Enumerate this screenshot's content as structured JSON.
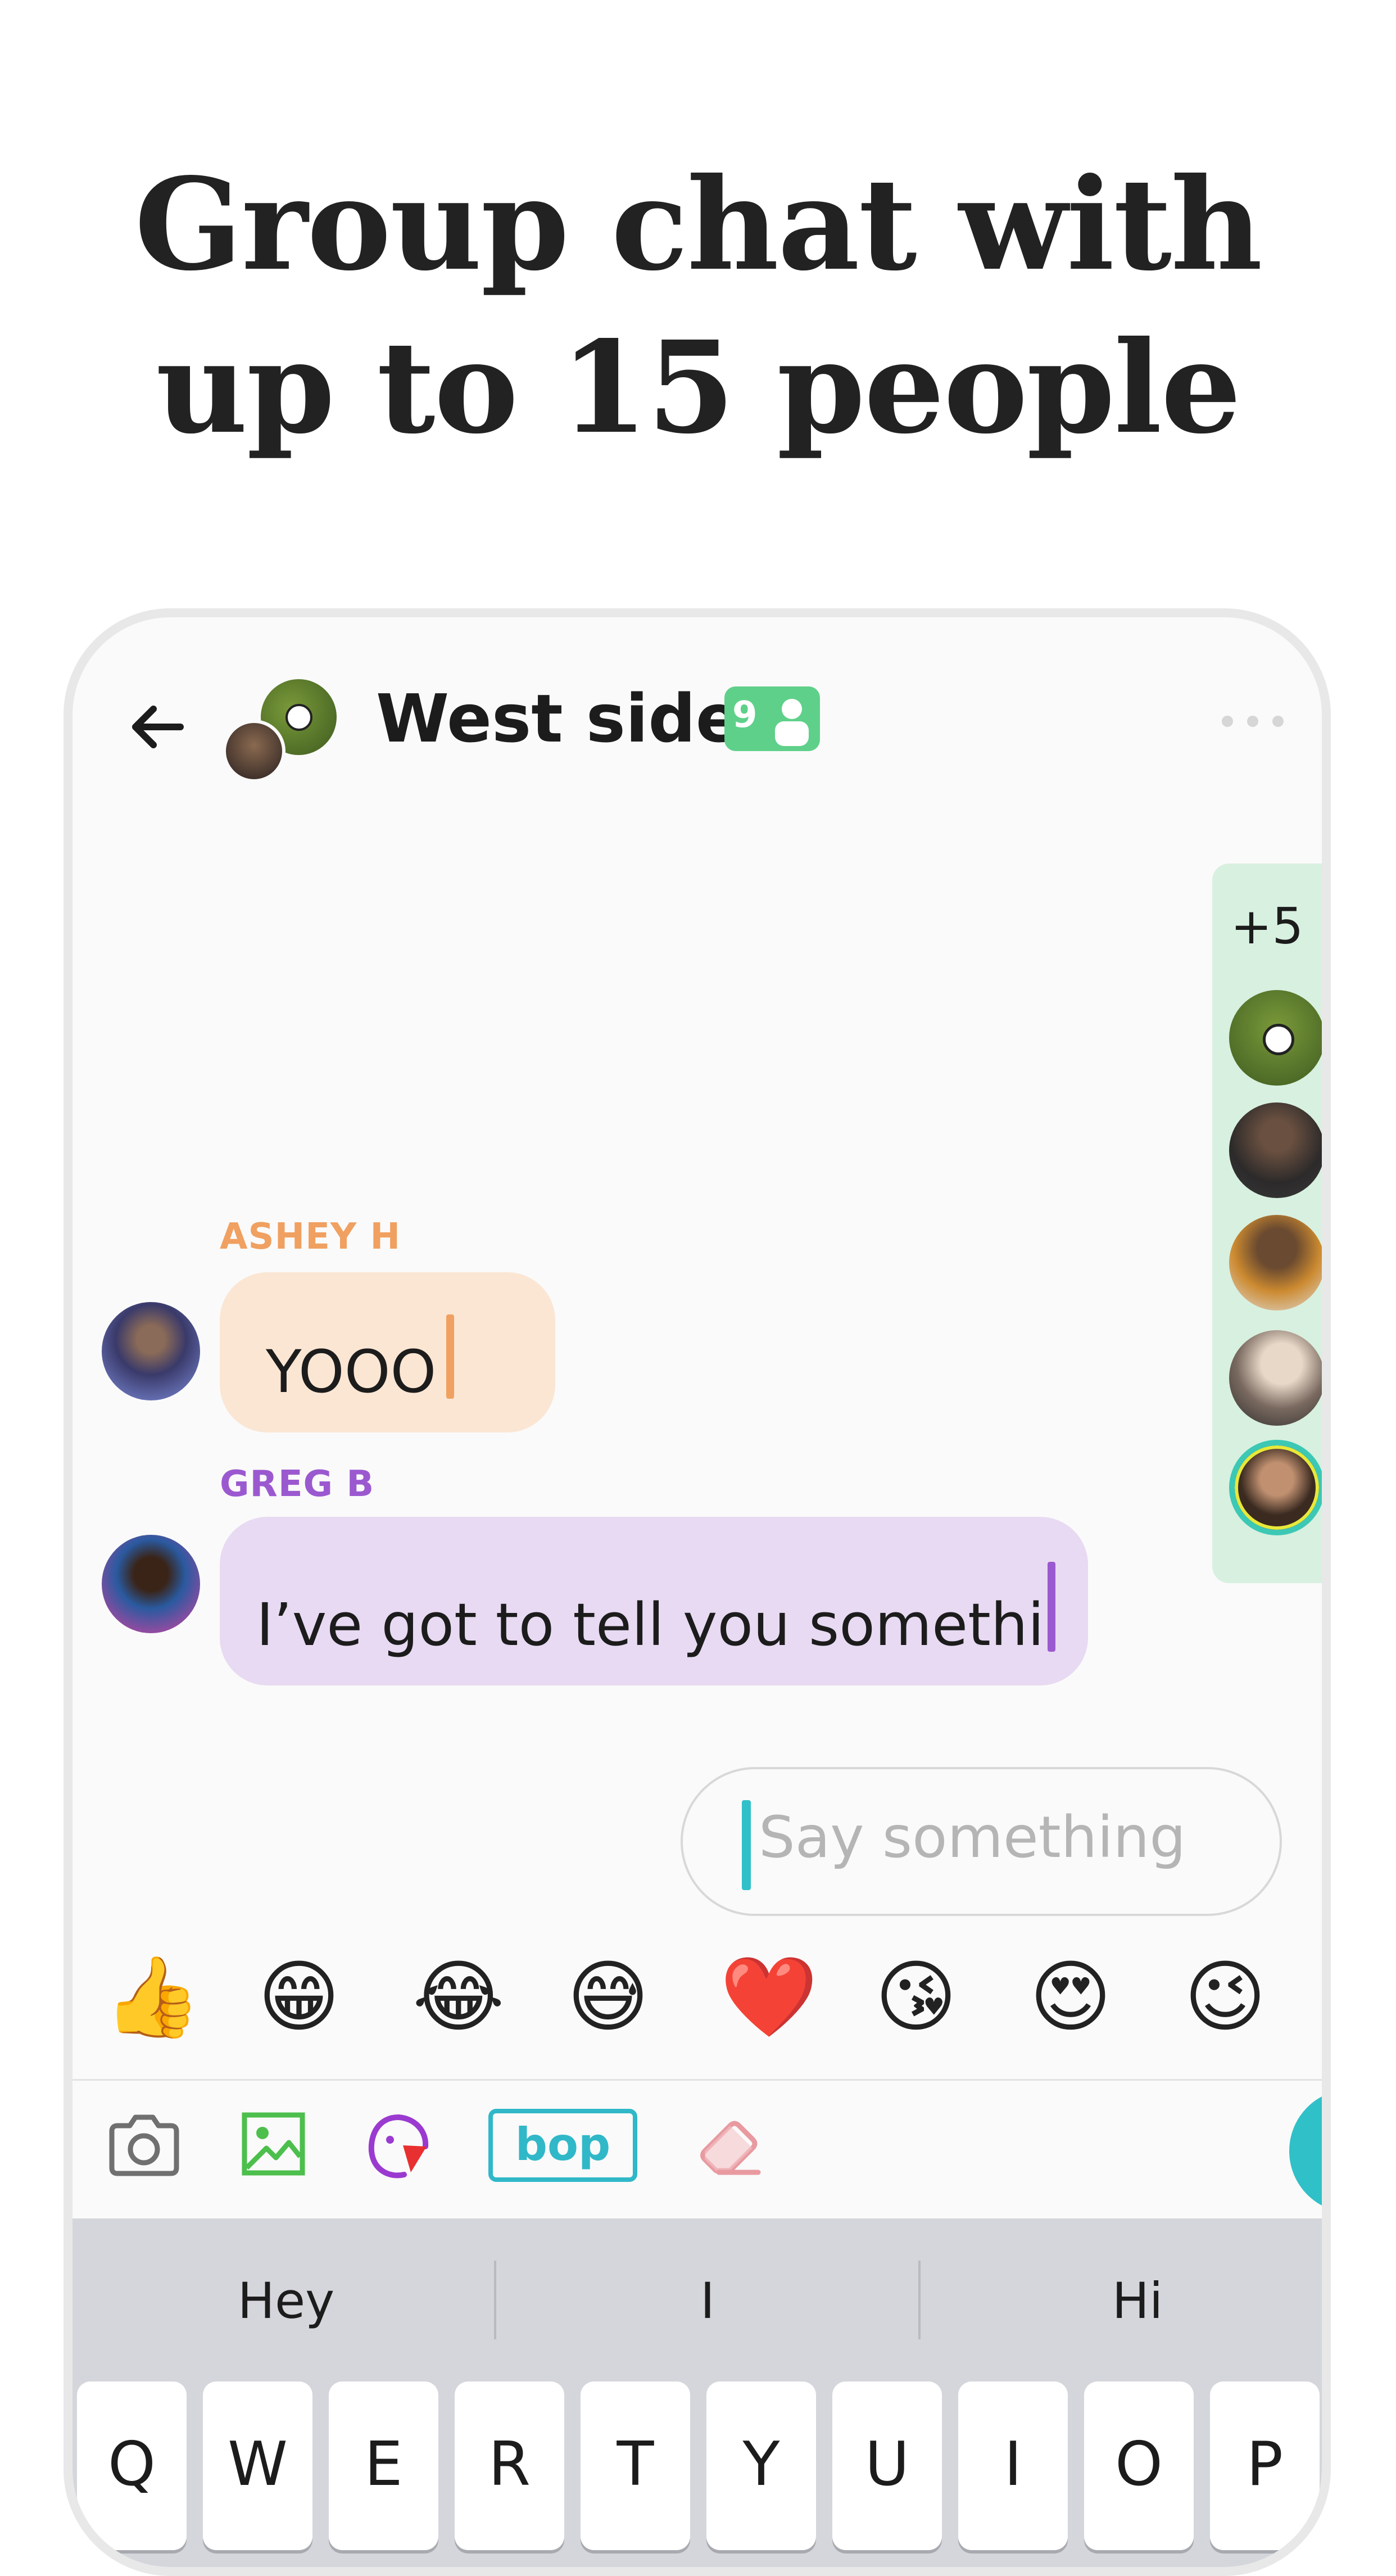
{
  "headline": {
    "line1": "Group chat with",
    "line2": "up to 15 people"
  },
  "header": {
    "title": "West side",
    "member_count": "9"
  },
  "rail": {
    "extra_count": "+5"
  },
  "messages": [
    {
      "sender": "ASHEY H",
      "text": "YOOO"
    },
    {
      "sender": "GREG B",
      "text": "I’ve got to tell you somethi"
    }
  ],
  "input": {
    "placeholder": "Say something"
  },
  "emojis": [
    "👍",
    "😁",
    "😂",
    "😅",
    "❤️",
    "😘",
    "😍",
    "😉"
  ],
  "toolbar": {
    "bop_label": "bop"
  },
  "keyboard": {
    "suggestions": [
      "Hey",
      "I",
      "Hi"
    ],
    "row1": [
      "Q",
      "W",
      "E",
      "R",
      "T",
      "Y",
      "U",
      "I",
      "O",
      "P"
    ]
  },
  "colors": {
    "accent_teal": "#30c0c8",
    "badge_green": "#5fd08a",
    "sender1": "#f0a060",
    "sender2": "#9b59d0"
  }
}
